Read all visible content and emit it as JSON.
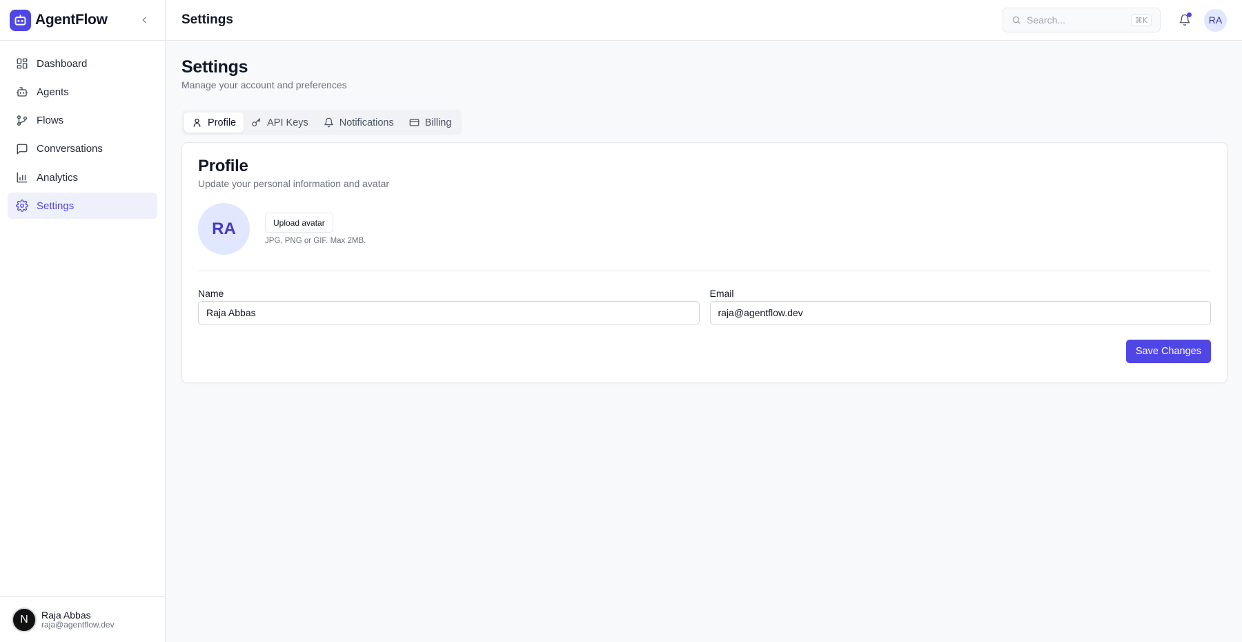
{
  "brand": {
    "name": "AgentFlow",
    "logo_icon": "bot-icon",
    "accent": "#4f46e5"
  },
  "sidebar": {
    "items": [
      {
        "label": "Dashboard",
        "icon": "dashboard-icon"
      },
      {
        "label": "Agents",
        "icon": "bot-icon"
      },
      {
        "label": "Flows",
        "icon": "git-branch-icon"
      },
      {
        "label": "Conversations",
        "icon": "message-square-icon"
      },
      {
        "label": "Analytics",
        "icon": "bar-chart-icon"
      },
      {
        "label": "Settings",
        "icon": "gear-icon",
        "active": true
      }
    ],
    "user": {
      "initial": "N",
      "name": "Raja Abbas",
      "email": "raja@agentflow.dev"
    }
  },
  "header": {
    "title": "Settings",
    "search": {
      "placeholder": "Search...",
      "shortcut": "⌘K"
    },
    "notification_dot": true,
    "avatar_initials": "RA"
  },
  "page": {
    "title": "Settings",
    "subtitle": "Manage your account and preferences",
    "tabs": [
      {
        "label": "Profile",
        "icon": "user-icon",
        "active": true
      },
      {
        "label": "API Keys",
        "icon": "key-icon"
      },
      {
        "label": "Notifications",
        "icon": "bell-icon"
      },
      {
        "label": "Billing",
        "icon": "credit-card-icon"
      }
    ]
  },
  "profile": {
    "title": "Profile",
    "subtitle": "Update your personal information and avatar",
    "avatar_initials": "RA",
    "upload_label": "Upload avatar",
    "upload_hint": "JPG, PNG or GIF. Max 2MB.",
    "name_label": "Name",
    "name_value": "Raja Abbas",
    "email_label": "Email",
    "email_value": "raja@agentflow.dev",
    "save_label": "Save Changes"
  }
}
